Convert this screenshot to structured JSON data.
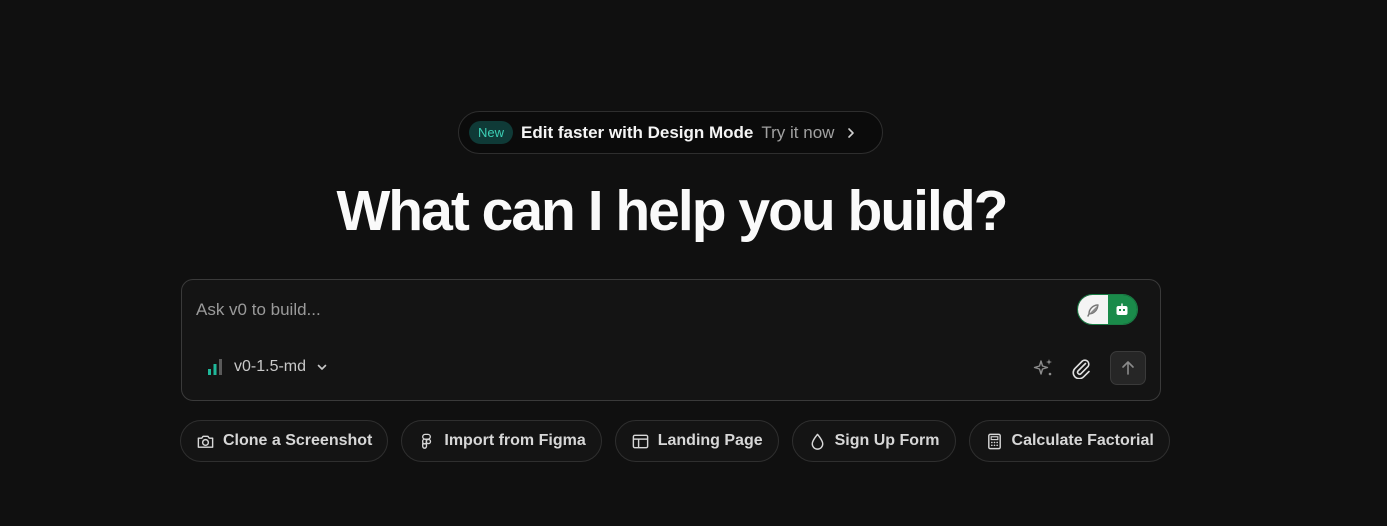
{
  "announcement": {
    "badge": "New",
    "headline": "Edit faster with Design Mode",
    "cta": "Try it now",
    "icon": "chevron-right-icon"
  },
  "heading": "What can I help you build?",
  "prompt": {
    "placeholder": "Ask v0 to build...",
    "value": "",
    "model_label": "v0-1.5-md",
    "toggle": {
      "left_icon": "feather-icon",
      "right_icon": "robot-icon"
    },
    "tools": [
      "sparkles-icon",
      "paperclip-icon"
    ],
    "send_icon": "arrow-up-icon"
  },
  "suggestions": [
    {
      "label": "Clone a Screenshot",
      "icon": "camera-icon"
    },
    {
      "label": "Import from Figma",
      "icon": "figma-icon"
    },
    {
      "label": "Landing Page",
      "icon": "layout-icon"
    },
    {
      "label": "Sign Up Form",
      "icon": "droplet-icon"
    },
    {
      "label": "Calculate Factorial",
      "icon": "calculator-icon"
    }
  ],
  "colors": {
    "background": "#101010",
    "badge_bg": "#0f3a37",
    "badge_text": "#3ccfb5",
    "toggle_green": "#1a8b4a",
    "model_bars": "#1fb89a"
  }
}
